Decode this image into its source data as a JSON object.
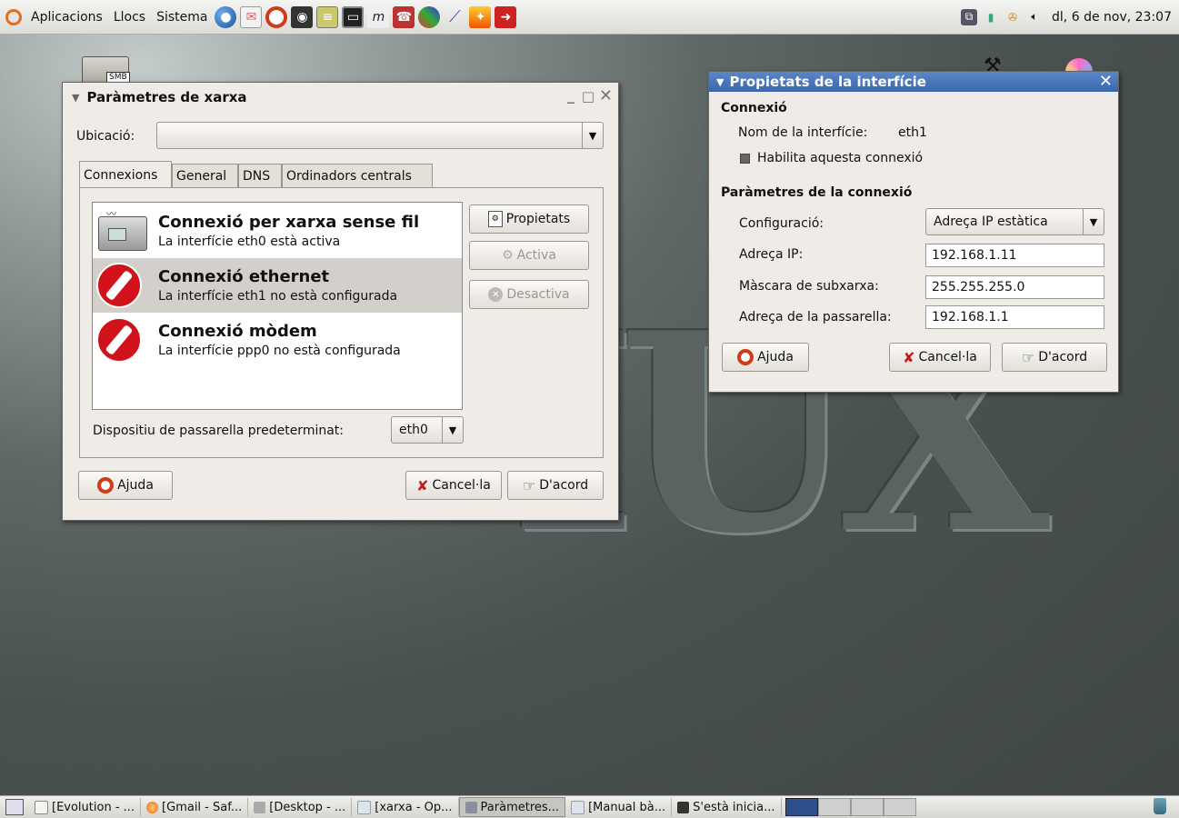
{
  "top_panel": {
    "menus": [
      "Aplicacions",
      "Llocs",
      "Sistema"
    ],
    "launchers": [
      "globe-icon",
      "mail-icon",
      "lifebuoy-icon",
      "camera-icon",
      "notes-icon",
      "terminal-icon",
      "text-editor-icon",
      "chat-icon",
      "paint-icon",
      "brush-icon",
      "fire-icon",
      "exit-icon"
    ],
    "clock": "dl, 6 de nov, 23:07"
  },
  "desktop": {
    "smb_label": "SMB"
  },
  "network_window": {
    "title": "Paràmetres de xarxa",
    "location_label": "Ubicació:",
    "location_value": "",
    "tabs": [
      "Connexions",
      "General",
      "DNS",
      "Ordinadors centrals"
    ],
    "connections": [
      {
        "name": "Connexió per xarxa sense fil",
        "desc": "La interfície eth0 està activa"
      },
      {
        "name": "Connexió ethernet",
        "desc": "La interfície eth1 no està configurada"
      },
      {
        "name": "Connexió mòdem",
        "desc": "La interfície ppp0 no està configurada"
      }
    ],
    "side_buttons": {
      "properties": "Propietats",
      "activate": "Activa",
      "deactivate": "Desactiva"
    },
    "gateway_label": "Dispositiu de passarella predeterminat:",
    "gateway_value": "eth0",
    "help": "Ajuda",
    "cancel": "Cancel·la",
    "ok": "D'acord"
  },
  "props_window": {
    "title": "Propietats de la interfície",
    "connection_heading": "Connexió",
    "interface_name_label": "Nom de la interfície:",
    "interface_name_value": "eth1",
    "enable_label": "Habilita aquesta connexió",
    "params_heading": "Paràmetres de la connexió",
    "config_label": "Configuració:",
    "config_value": "Adreça IP estàtica",
    "ip_label": "Adreça IP:",
    "ip_value": "192.168.1.11",
    "mask_label": "Màscara de subxarxa:",
    "mask_value": "255.255.255.0",
    "gateway_label": "Adreça de la passarella:",
    "gateway_value": "192.168.1.1",
    "help": "Ajuda",
    "cancel": "Cancel·la",
    "ok": "D'acord"
  },
  "taskbar": {
    "tasks": [
      "[Evolution - ...",
      "[Gmail - Saf...",
      "[Desktop - ...",
      "[xarxa - Op...",
      "Paràmetres...",
      "[Manual bà...",
      "S'està inicia..."
    ]
  }
}
